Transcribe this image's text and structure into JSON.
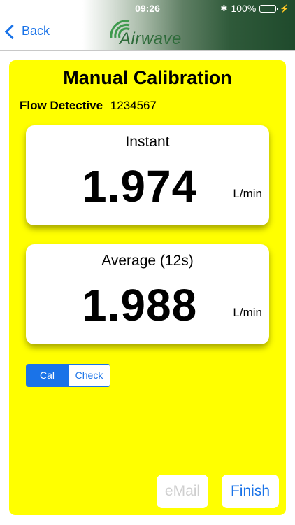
{
  "status_bar": {
    "time": "09:26",
    "battery": "100%"
  },
  "nav": {
    "back_label": "Back",
    "logo_text": "Airwave"
  },
  "panel": {
    "title": "Manual Calibration",
    "device_name": "Flow Detective",
    "device_serial": "1234567"
  },
  "instant": {
    "label": "Instant",
    "value": "1.974",
    "unit": "L/min"
  },
  "average": {
    "label": "Average (12s)",
    "value": "1.988",
    "unit": "L/min"
  },
  "mode": {
    "options": [
      "Cal",
      "Check"
    ],
    "selected": "Cal"
  },
  "actions": {
    "email_label": "eMail",
    "email_enabled": false,
    "finish_label": "Finish"
  },
  "colors": {
    "panel_background": "#ffff00",
    "accent": "#1a73e8",
    "header_green": "#1f4a2c",
    "logo_green": "#2e6b3a"
  },
  "icons": [
    "back-chevron-icon",
    "bluetooth-icon",
    "battery-icon",
    "charging-icon",
    "airwave-logo-waves-icon"
  ]
}
